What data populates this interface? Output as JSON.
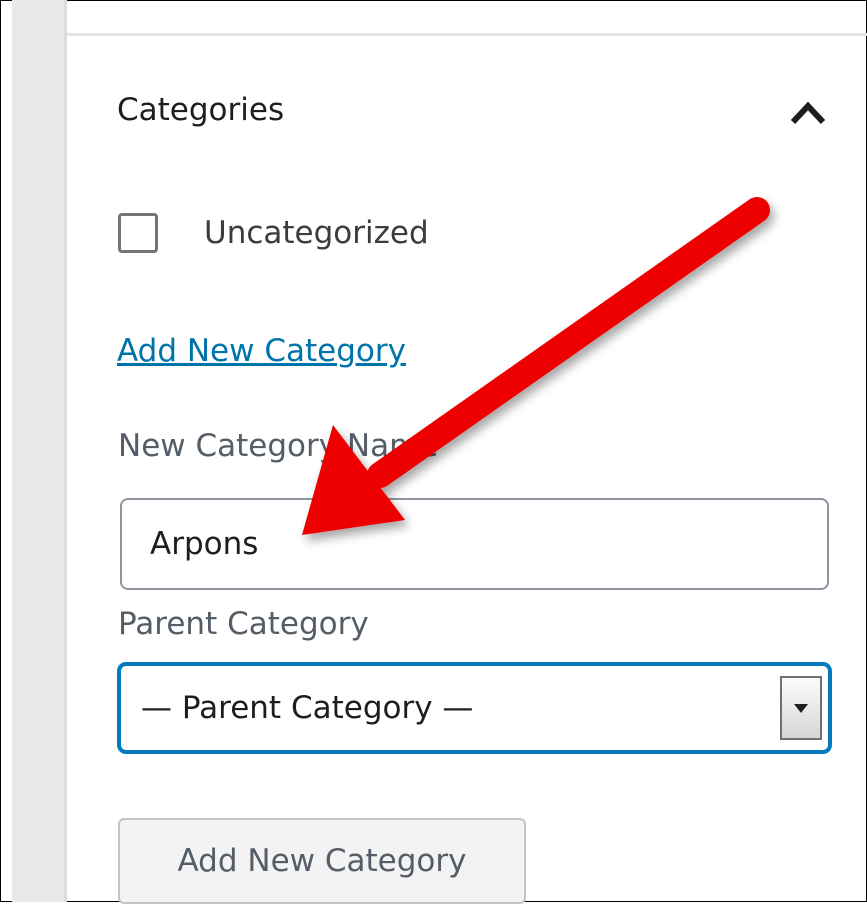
{
  "panel": {
    "title": "Categories",
    "collapse_icon": "chevron-up-icon"
  },
  "categories": [
    {
      "label": "Uncategorized",
      "checked": false
    }
  ],
  "add_new_link": "Add New Category",
  "new_category": {
    "label": "New Category Name",
    "value": "Arpons"
  },
  "parent_category": {
    "label": "Parent Category",
    "selected": "— Parent Category —",
    "dropdown_icon": "caret-down-icon"
  },
  "submit_button": "Add New Category",
  "annotation": {
    "icon": "red-arrow-icon",
    "color": "#ee0000"
  },
  "colors": {
    "link": "#0073aa",
    "focus": "#007cba"
  }
}
